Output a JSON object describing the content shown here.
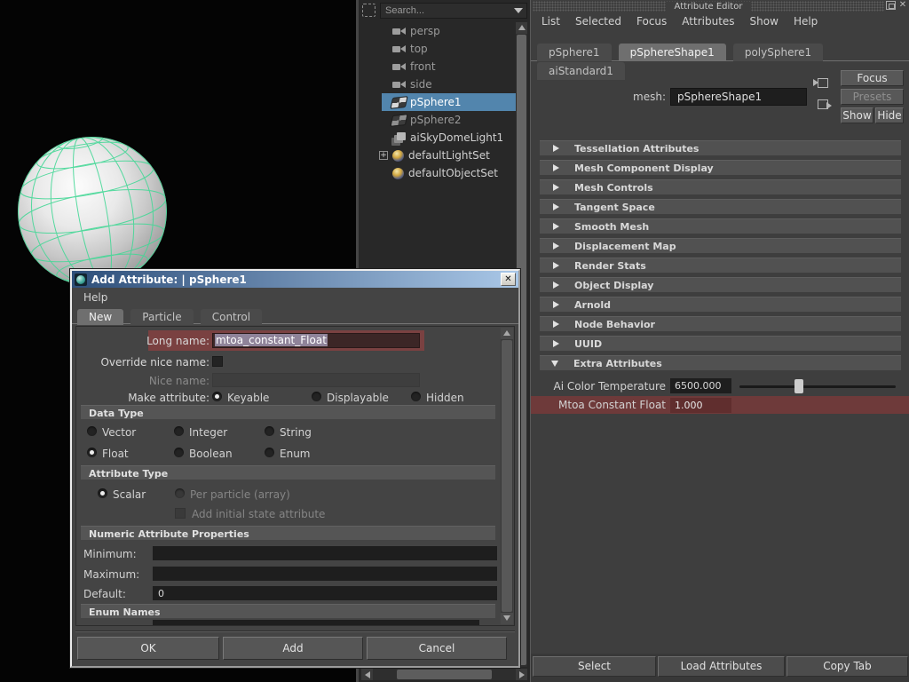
{
  "outliner": {
    "search_placeholder": "Search...",
    "items": [
      {
        "label": "persp"
      },
      {
        "label": "top"
      },
      {
        "label": "front"
      },
      {
        "label": "side"
      },
      {
        "label": "pSphere1"
      },
      {
        "label": "pSphere2"
      },
      {
        "label": "aiSkyDomeLight1"
      },
      {
        "label": "defaultLightSet"
      },
      {
        "label": "defaultObjectSet"
      }
    ],
    "expander_glyph": "+"
  },
  "attribute_editor": {
    "title": "Attribute Editor",
    "menus": [
      {
        "label": "List"
      },
      {
        "label": "Selected"
      },
      {
        "label": "Focus"
      },
      {
        "label": "Attributes"
      },
      {
        "label": "Show"
      },
      {
        "label": "Help"
      }
    ],
    "tabs": [
      {
        "label": "pSphere1"
      },
      {
        "label": "pSphereShape1"
      },
      {
        "label": "polySphere1"
      },
      {
        "label": "aiStandard1"
      }
    ],
    "mesh_label": "mesh:",
    "mesh_value": "pSphereShape1",
    "focus_button": "Focus",
    "presets_button": "Presets",
    "show_button": "Show",
    "hide_button": "Hide",
    "sections": [
      {
        "label": "Tessellation Attributes"
      },
      {
        "label": "Mesh Component Display"
      },
      {
        "label": "Mesh Controls"
      },
      {
        "label": "Tangent Space"
      },
      {
        "label": "Smooth Mesh"
      },
      {
        "label": "Displacement Map"
      },
      {
        "label": "Render Stats"
      },
      {
        "label": "Object Display"
      },
      {
        "label": "Arnold"
      },
      {
        "label": "Node Behavior"
      },
      {
        "label": "UUID"
      },
      {
        "label": "Extra Attributes"
      }
    ],
    "extra_attributes": {
      "color_temperature": {
        "label": "Ai Color Temperature",
        "value": "6500.000"
      },
      "constant_float": {
        "label": "Mtoa Constant Float",
        "value": "1.000"
      }
    },
    "footer": [
      {
        "label": "Select"
      },
      {
        "label": "Load Attributes"
      },
      {
        "label": "Copy Tab"
      }
    ]
  },
  "dialog": {
    "title": "Add Attribute: | pSphere1",
    "menu_help": "Help",
    "tabs": [
      {
        "label": "New"
      },
      {
        "label": "Particle"
      },
      {
        "label": "Control"
      }
    ],
    "long_name": {
      "label": "Long name:",
      "value": "mtoa_constant_Float"
    },
    "override_nice_name_label": "Override nice name:",
    "nice_name_label": "Nice name:",
    "make_attribute": {
      "label": "Make attribute:",
      "options": [
        {
          "label": "Keyable"
        },
        {
          "label": "Displayable"
        },
        {
          "label": "Hidden"
        }
      ]
    },
    "data_type": {
      "header": "Data Type",
      "options": [
        {
          "label": "Vector"
        },
        {
          "label": "Integer"
        },
        {
          "label": "String"
        },
        {
          "label": "Float"
        },
        {
          "label": "Boolean"
        },
        {
          "label": "Enum"
        }
      ]
    },
    "attribute_type": {
      "header": "Attribute Type",
      "scalar": "Scalar",
      "per_particle": "Per particle (array)",
      "initial_state": "Add initial state attribute"
    },
    "numeric": {
      "header": "Numeric Attribute Properties",
      "minimum_label": "Minimum:",
      "maximum_label": "Maximum:",
      "default_label": "Default:",
      "default_value": "0"
    },
    "enum_names_header": "Enum Names",
    "buttons": [
      {
        "label": "OK"
      },
      {
        "label": "Add"
      },
      {
        "label": "Cancel"
      }
    ]
  },
  "colors": {
    "selection_blue": "#5285ad",
    "highlight_maroon": "#6e3a3a",
    "wireframe_green": "#44d796",
    "titlebar_gradient_left": "#2e4f7a",
    "titlebar_gradient_right": "#a9c7e7"
  }
}
